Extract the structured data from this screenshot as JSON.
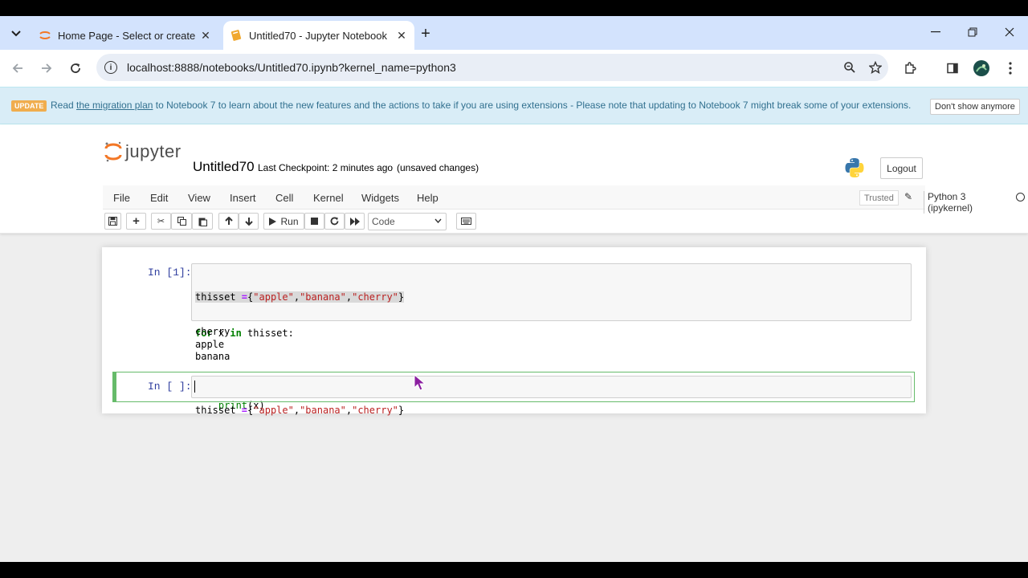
{
  "browser": {
    "tabs": [
      {
        "title": "Home Page - Select or create a",
        "active": false
      },
      {
        "title": "Untitled70 - Jupyter Notebook",
        "active": true
      }
    ],
    "url": "localhost:8888/notebooks/Untitled70.ipynb?kernel_name=python3"
  },
  "banner": {
    "badge": "UPDATE",
    "prefix": "Read ",
    "link": "the migration plan",
    "suffix": " to Notebook 7 to learn about the new features and the actions to take if you are using extensions - Please note that updating to Notebook 7 might break some of your extensions.",
    "dismiss": "Don't show anymore"
  },
  "header": {
    "logo_text": "jupyter",
    "notebook_name": "Untitled70",
    "checkpoint": "Last Checkpoint: 2 minutes ago",
    "unsaved": "(unsaved changes)",
    "logout": "Logout"
  },
  "menu": {
    "items": [
      "File",
      "Edit",
      "View",
      "Insert",
      "Cell",
      "Kernel",
      "Widgets",
      "Help"
    ],
    "trusted": "Trusted",
    "kernel": "Python 3 (ipykernel)"
  },
  "toolbar": {
    "run_label": "Run",
    "cell_type": "Code"
  },
  "cells": [
    {
      "prompt": "In [1]:",
      "lines": [
        "thisset ={\"apple\",\"banana\",\"cherry\"}",
        "for x in thisset:",
        "",
        "    print(x)"
      ],
      "output": [
        "cherry",
        "apple",
        "banana"
      ]
    },
    {
      "prompt": "In [ ]:",
      "lines": [
        "thisset ={\"apple\",\"banana\",\"cherry\"}"
      ]
    }
  ]
}
